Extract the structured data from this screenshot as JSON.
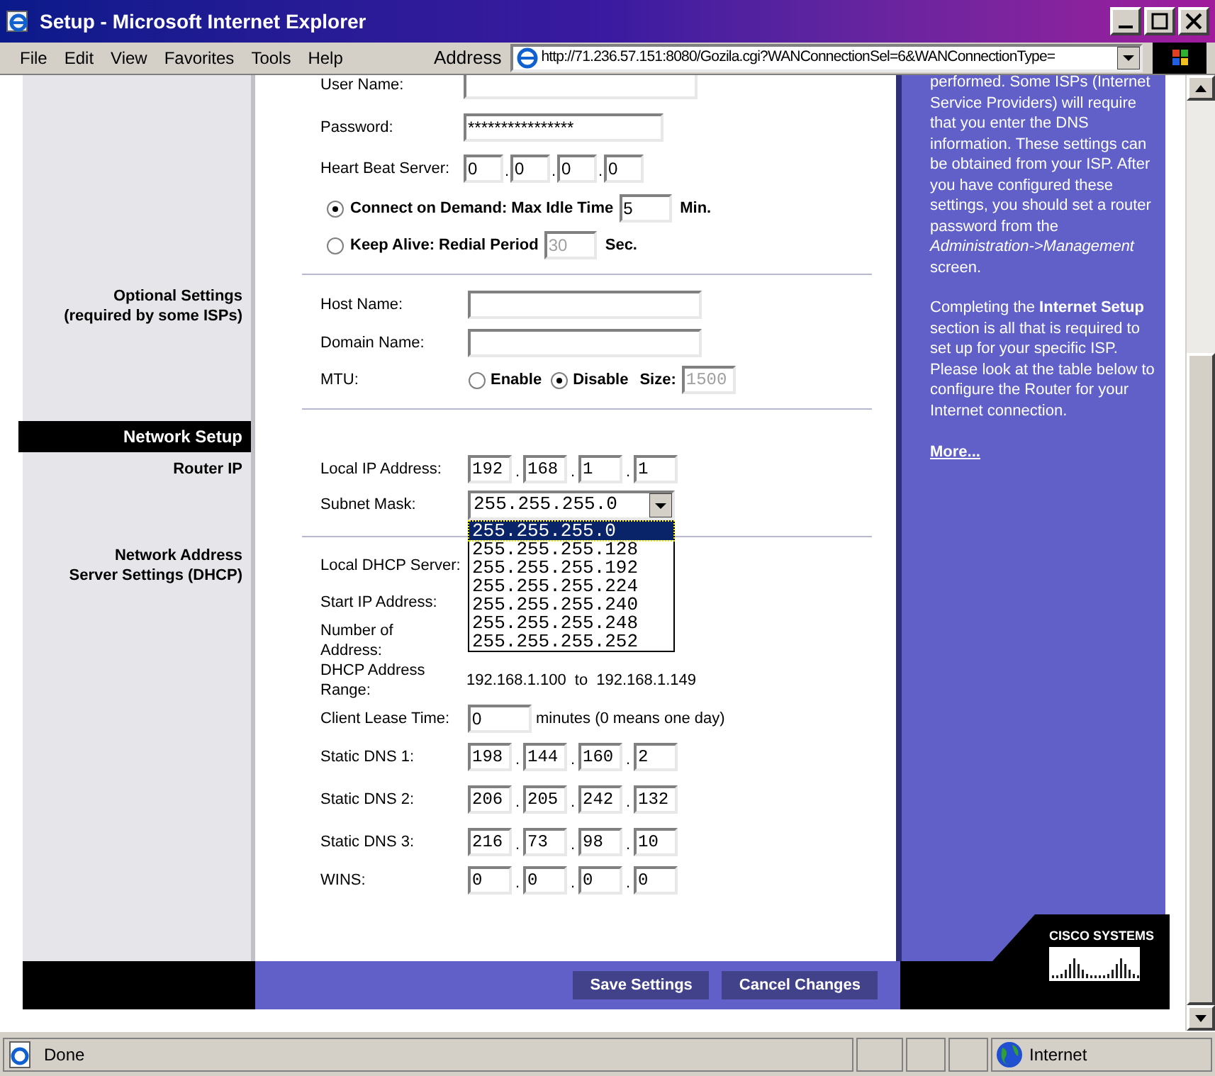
{
  "window": {
    "title": "Setup - Microsoft Internet Explorer"
  },
  "menu": [
    "File",
    "Edit",
    "View",
    "Favorites",
    "Tools",
    "Help"
  ],
  "address": {
    "label": "Address",
    "url": "http://71.236.57.151:8080/Gozila.cgi?WANConnectionSel=6&WANConnectionType="
  },
  "pppoe": {
    "user_name_label": "User Name:",
    "password_label": "Password:",
    "password": "****************",
    "heart_beat_label": "Heart Beat Server:",
    "heart_beat": [
      "0",
      "0",
      "0",
      "0"
    ],
    "modes": [
      {
        "label": "Connect on Demand: Max Idle Time",
        "value": "5",
        "unit": "Min.",
        "selected": true,
        "disabled": false
      },
      {
        "label": "Keep Alive: Redial Period",
        "value": "30",
        "unit": "Sec.",
        "selected": false,
        "disabled": true
      }
    ]
  },
  "optional": {
    "heading": [
      "Optional Settings",
      "(required by some ISPs)"
    ],
    "host_name_label": "Host Name:",
    "domain_name_label": "Domain Name:",
    "mtu_label": "MTU:",
    "mtu_options": [
      {
        "label": "Enable",
        "selected": false
      },
      {
        "label": "Disable",
        "selected": true
      }
    ],
    "size_label": "Size:",
    "size": "1500",
    "size_disabled": true
  },
  "octet_separator": ".",
  "network_setup": {
    "title": "Network Setup",
    "router_ip_heading": "Router IP",
    "local_ip_label": "Local IP Address:",
    "local_ip": [
      "192",
      "168",
      "1",
      "1"
    ],
    "subnet_label": "Subnet Mask:",
    "subnet": "255.255.255.0",
    "subnet_options": [
      {
        "label": "255.255.255.0",
        "selected": true
      },
      {
        "label": "255.255.255.128",
        "selected": false
      },
      {
        "label": "255.255.255.192",
        "selected": false
      },
      {
        "label": "255.255.255.224",
        "selected": false
      },
      {
        "label": "255.255.255.240",
        "selected": false
      },
      {
        "label": "255.255.255.248",
        "selected": false
      },
      {
        "label": "255.255.255.252",
        "selected": false
      }
    ]
  },
  "dhcp": {
    "heading": [
      "Network Address",
      "Server Settings (DHCP)"
    ],
    "server_label": "Local DHCP Server:",
    "start_ip_label": "Start IP Address:",
    "number_label": [
      "Number of",
      "Address:"
    ],
    "range_label": [
      "DHCP Address",
      "Range:"
    ],
    "range": "192.168.1.100 to 192.168.1.149",
    "lease_label": "Client Lease Time:",
    "lease": "0",
    "lease_note": "minutes (0 means one day)",
    "dns": [
      {
        "label": "Static DNS 1:",
        "octets": [
          "198",
          "144",
          "160",
          "2"
        ]
      },
      {
        "label": "Static DNS 2:",
        "octets": [
          "206",
          "205",
          "242",
          "132"
        ]
      },
      {
        "label": "Static DNS 3:",
        "octets": [
          "216",
          "73",
          "98",
          "10"
        ]
      },
      {
        "label": "WINS:",
        "octets": [
          "0",
          "0",
          "0",
          "0"
        ]
      }
    ]
  },
  "buttons": [
    "Save Settings",
    "Cancel Changes"
  ],
  "help": {
    "paragraphs": [
      "performed. Some ISPs (Internet Service Providers) will require that you enter the DNS information. These settings can be obtained from your ISP. After you have configured these settings, you should set a router password from the *Administration->Management* screen.",
      "Completing the **Internet Setup** section is all that is required to set up for your specific ISP. Please look at the table below to configure the Router for your Internet connection."
    ],
    "more_link": "More..."
  },
  "logo": "CISCO SYSTEMS",
  "status": {
    "text": "Done",
    "zone": "Internet"
  }
}
